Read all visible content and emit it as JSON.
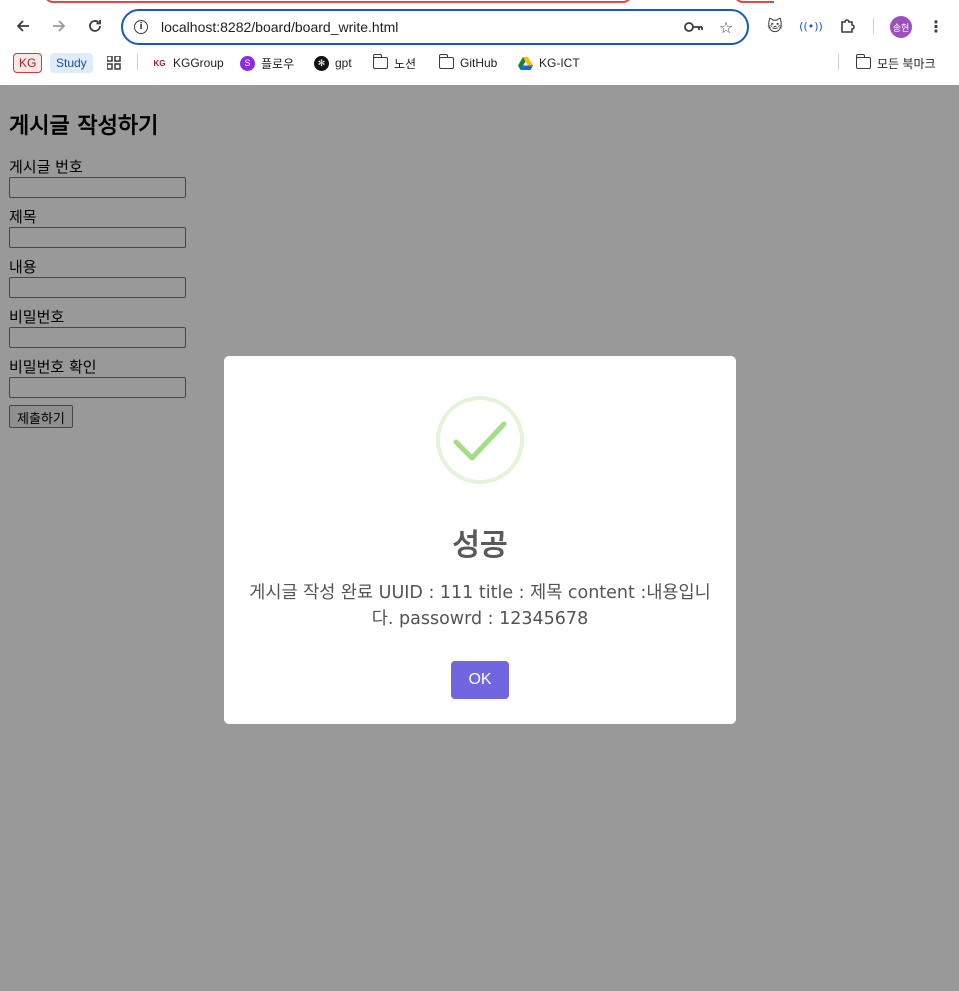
{
  "browser": {
    "url": "localhost:8282/board/board_write.html",
    "profile_initials": "송현",
    "bookmarks": [
      {
        "label": "KG"
      },
      {
        "label": "Study"
      },
      {
        "label": "KGGroup"
      },
      {
        "label": "플로우"
      },
      {
        "label": "gpt"
      },
      {
        "label": "노션"
      },
      {
        "label": "GitHub"
      },
      {
        "label": "KG-ICT"
      }
    ],
    "all_bookmarks_label": "모든 북마크"
  },
  "form": {
    "heading": "게시글 작성하기",
    "fields": [
      {
        "label": "게시글 번호"
      },
      {
        "label": "제목"
      },
      {
        "label": "내용"
      },
      {
        "label": "비밀번호"
      },
      {
        "label": "비밀번호 확인"
      }
    ],
    "submit_label": "제출하기"
  },
  "dialog": {
    "title": "성공",
    "message": "게시글 작성 완료 UUID : 111 title : 제목 content :내용입니다. passowrd : 12345678",
    "ok_label": "OK",
    "icon": "success-check-icon",
    "confirm_color": "#7066e0",
    "success_color": "#a5dc86"
  }
}
